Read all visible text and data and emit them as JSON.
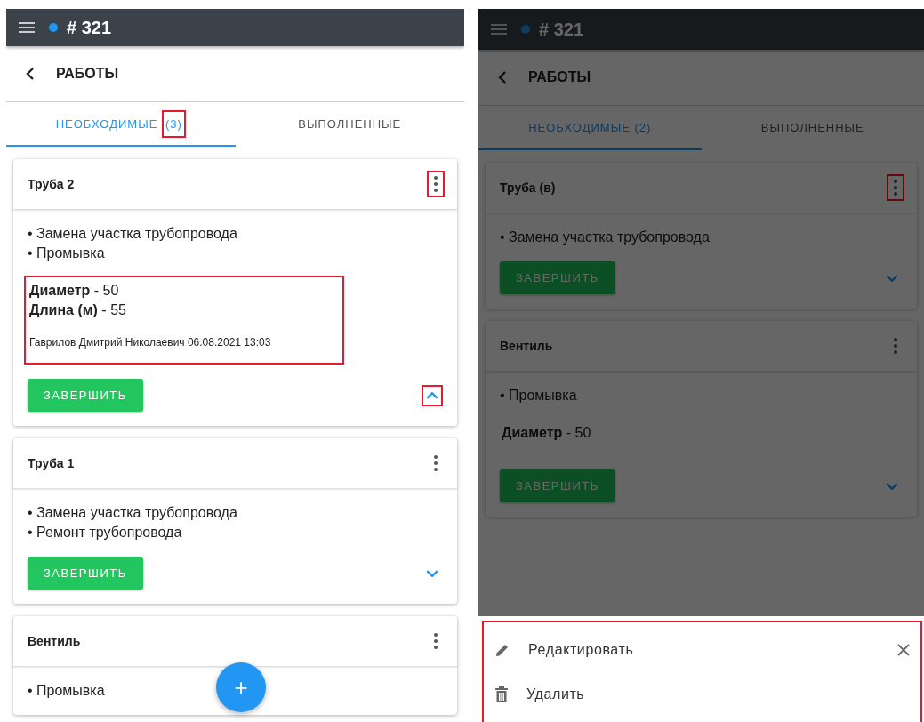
{
  "screens": [
    {
      "dimmed": false,
      "header": {
        "title": "# 321"
      },
      "page_title": "РАБОТЫ",
      "tabs": [
        {
          "label": "НЕОБХОДИМЫЕ",
          "count": "(3)",
          "count_highlighted": true,
          "selected": true
        },
        {
          "label": "ВЫПОЛНЕННЫЕ",
          "selected": false
        }
      ],
      "cards": [
        {
          "title": "Труба 2",
          "menu_highlighted": true,
          "works": [
            "• Замена участка трубопровода",
            "• Промывка"
          ],
          "details": {
            "highlighted": true,
            "params": [
              "**Диаметр** - 50",
              "**Длина (м)** - 55"
            ],
            "author": "Гаврилов Дмитрий Николаевич 06.08.2021 13:03"
          },
          "button": "ЗАВЕРШИТЬ",
          "expanded": true,
          "toggle_highlighted": true
        },
        {
          "title": "Труба 1",
          "menu_highlighted": false,
          "works": [
            "• Замена участка трубопровода",
            "• Ремонт трубопровода"
          ],
          "button": "ЗАВЕРШИТЬ",
          "expanded": false,
          "toggle_highlighted": false
        },
        {
          "title": "Вентиль",
          "menu_highlighted": false,
          "works": [
            "• Промывка"
          ]
        }
      ],
      "fab": {
        "label": "+"
      }
    },
    {
      "dimmed": true,
      "header": {
        "title": "# 321"
      },
      "page_title": "РАБОТЫ",
      "tabs": [
        {
          "label": "НЕОБХОДИМЫЕ (2)",
          "selected": true
        },
        {
          "label": "ВЫПОЛНЕННЫЕ",
          "selected": false
        }
      ],
      "cards": [
        {
          "title": "Труба (в)",
          "menu_highlighted": true,
          "works": [
            "• Замена участка трубопровода"
          ],
          "button": "ЗАВЕРШИТЬ",
          "expanded": false,
          "toggle_highlighted": false
        },
        {
          "title": "Вентиль",
          "menu_highlighted": false,
          "works": [
            "• Промывка"
          ],
          "details": {
            "highlighted": false,
            "params": [
              "**Диаметр** - 50"
            ]
          },
          "button": "ЗАВЕРШИТЬ",
          "expanded": false,
          "toggle_highlighted": false
        }
      ],
      "sheet": {
        "highlighted": true,
        "items": [
          {
            "kind": "edit",
            "label": "Редактировать"
          },
          {
            "kind": "delete",
            "label": "Удалить"
          }
        ]
      }
    }
  ]
}
